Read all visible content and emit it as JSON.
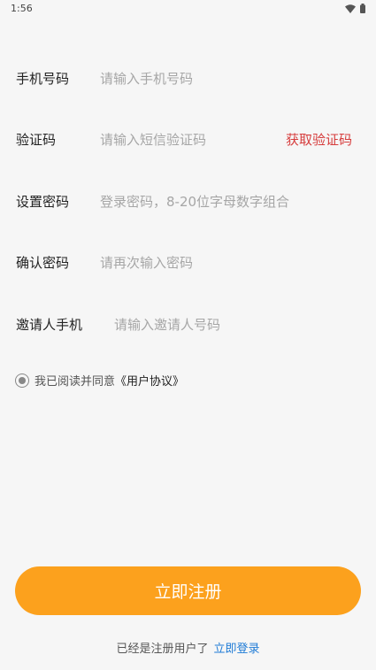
{
  "status_bar": {
    "time": "1:56",
    "icons": [
      "wifi-icon",
      "battery-icon"
    ]
  },
  "form": {
    "phone": {
      "label": "手机号码",
      "placeholder": "请输入手机号码",
      "value": ""
    },
    "code": {
      "label": "验证码",
      "placeholder": "请输入短信验证码",
      "value": "",
      "get_code_label": "获取验证码"
    },
    "password": {
      "label": "设置密码",
      "placeholder": "登录密码，8-20位字母数字组合",
      "value": ""
    },
    "confirm": {
      "label": "确认密码",
      "placeholder": "请再次输入密码",
      "value": ""
    },
    "inviter": {
      "label": "邀请人手机",
      "placeholder": "请输入邀请人号码",
      "value": ""
    }
  },
  "agreement": {
    "text": "我已阅读并同意",
    "link": "《用户协议》"
  },
  "register_button": {
    "label": "立即注册"
  },
  "footer": {
    "text": "已经是注册用户了",
    "login_link": "立即登录"
  },
  "colors": {
    "accent": "#fca11d",
    "get_code": "#d63c3c",
    "login_link": "#1f7bd6",
    "background": "#f6f6f6"
  }
}
